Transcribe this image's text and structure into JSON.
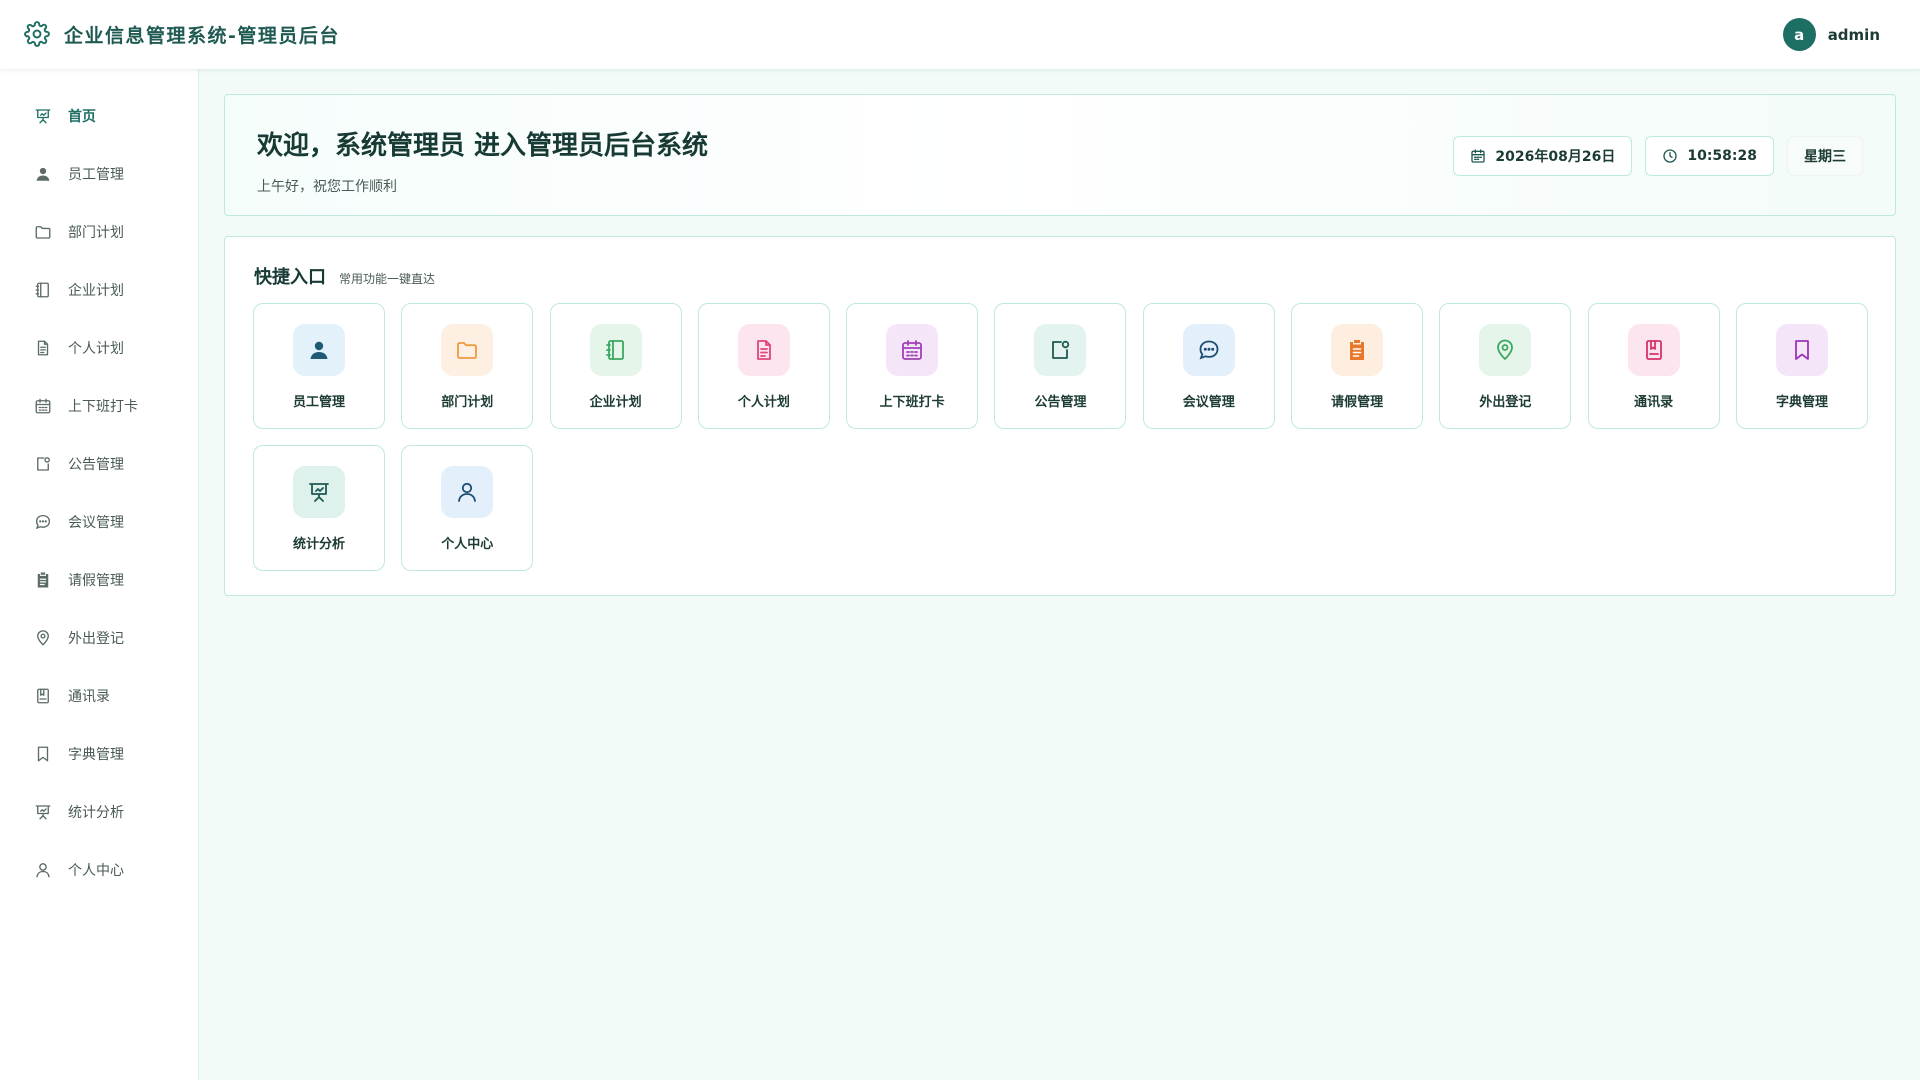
{
  "header": {
    "title": "企业信息管理系统-管理员后台",
    "avatar_letter": "a",
    "username": "admin"
  },
  "sidebar": {
    "items": [
      {
        "label": "首页",
        "icon": "presentation-icon",
        "active": true
      },
      {
        "label": "员工管理",
        "icon": "user-filled-icon"
      },
      {
        "label": "部门计划",
        "icon": "folder-icon"
      },
      {
        "label": "企业计划",
        "icon": "notebook-icon"
      },
      {
        "label": "个人计划",
        "icon": "document-icon"
      },
      {
        "label": "上下班打卡",
        "icon": "calendar-icon"
      },
      {
        "label": "公告管理",
        "icon": "notice-icon"
      },
      {
        "label": "会议管理",
        "icon": "chat-dot-icon"
      },
      {
        "label": "请假管理",
        "icon": "clipboard-icon"
      },
      {
        "label": "外出登记",
        "icon": "location-icon"
      },
      {
        "label": "通讯录",
        "icon": "address-book-icon"
      },
      {
        "label": "字典管理",
        "icon": "bookmark-icon"
      },
      {
        "label": "统计分析",
        "icon": "chart-board-icon"
      },
      {
        "label": "个人中心",
        "icon": "user-outline-icon"
      }
    ]
  },
  "welcome": {
    "title": "欢迎，系统管理员 进入管理员后台系统",
    "subtitle": "上午好，祝您工作顺利",
    "date": "2026年08月26日",
    "time": "10:58:28",
    "weekday": "星期三"
  },
  "quick": {
    "title": "快捷入口",
    "subtitle": "常用功能一键直达",
    "cards": [
      {
        "label": "员工管理",
        "icon": "user-filled-icon",
        "color": "#1e5a73",
        "bg": "#e3f1fb"
      },
      {
        "label": "部门计划",
        "icon": "folder-icon",
        "color": "#f09a3e",
        "bg": "#fdf0e3"
      },
      {
        "label": "企业计划",
        "icon": "notebook-icon",
        "color": "#3aa85f",
        "bg": "#e5f5ea"
      },
      {
        "label": "个人计划",
        "icon": "document-icon",
        "color": "#e0457b",
        "bg": "#fce5ee"
      },
      {
        "label": "上下班打卡",
        "icon": "calendar-icon",
        "color": "#a33fb8",
        "bg": "#f5e5f8"
      },
      {
        "label": "公告管理",
        "icon": "notice-icon",
        "color": "#1f5a52",
        "bg": "#e3f3ef"
      },
      {
        "label": "会议管理",
        "icon": "chat-dot-icon",
        "color": "#1e4f73",
        "bg": "#e3f0fb"
      },
      {
        "label": "请假管理",
        "icon": "clipboard-icon",
        "color": "#e8792c",
        "bg": "#fdeee0"
      },
      {
        "label": "外出登记",
        "icon": "location-icon",
        "color": "#3aa85f",
        "bg": "#e5f5ea"
      },
      {
        "label": "通讯录",
        "icon": "address-book-icon",
        "color": "#d6336c",
        "bg": "#fce5ee"
      },
      {
        "label": "字典管理",
        "icon": "bookmark-icon",
        "color": "#9c36b5",
        "bg": "#f5e5f8"
      },
      {
        "label": "统计分析",
        "icon": "chart-board-icon",
        "color": "#1f5a52",
        "bg": "#dff1ec"
      },
      {
        "label": "个人中心",
        "icon": "user-outline-icon",
        "color": "#1e4f73",
        "bg": "#e3f0fb"
      }
    ]
  }
}
